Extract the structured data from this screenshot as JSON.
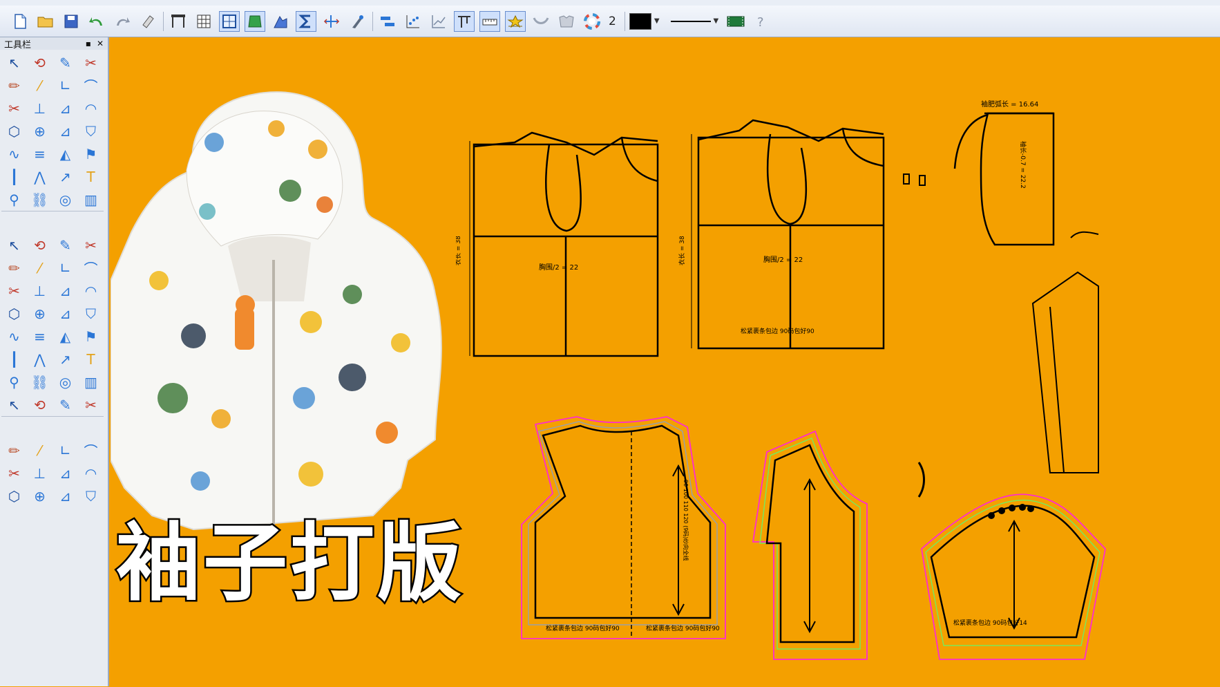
{
  "app": {
    "panel_title": "工具栏",
    "pin_glyph": "📌",
    "close_glyph": "✕"
  },
  "toolbar": {
    "items": [
      {
        "icon": "new-file-icon"
      },
      {
        "icon": "open-folder-icon"
      },
      {
        "icon": "save-icon"
      },
      {
        "icon": "undo-icon"
      },
      {
        "icon": "redo-icon"
      },
      {
        "icon": "eraser-icon"
      },
      {
        "icon": "layout-icon"
      },
      {
        "icon": "grid-icon"
      },
      {
        "icon": "window-icon"
      },
      {
        "icon": "pattern-icon"
      },
      {
        "icon": "piece-icon"
      },
      {
        "icon": "sigma-icon"
      },
      {
        "icon": "measure-icon"
      },
      {
        "icon": "brush-icon"
      },
      {
        "icon": "align-icon"
      },
      {
        "icon": "scatter-icon"
      },
      {
        "icon": "chart-icon"
      },
      {
        "icon": "size-icon"
      },
      {
        "icon": "ruler-icon"
      },
      {
        "icon": "mark-icon"
      },
      {
        "icon": "cup-icon"
      },
      {
        "icon": "shirt-icon"
      },
      {
        "icon": "color-wheel-icon"
      }
    ],
    "line_width": "2",
    "color": "#000000"
  },
  "canvas": {
    "caption": "袖子打版",
    "labels": {
      "bust": "胸围/2 = 22",
      "length": "衣长 = 38",
      "back_length": "衣长 = 38",
      "sleeve_top": "袖肥弧长 = 16.64",
      "sleeve_mid": "袖长-0.7 = 22.2",
      "hem_note": "松紧裹条包边 90码包好90",
      "hem_note2": "松紧裹条包边 90码包好14",
      "grain": "90 100 110 120 (9码)纱向全线"
    }
  }
}
